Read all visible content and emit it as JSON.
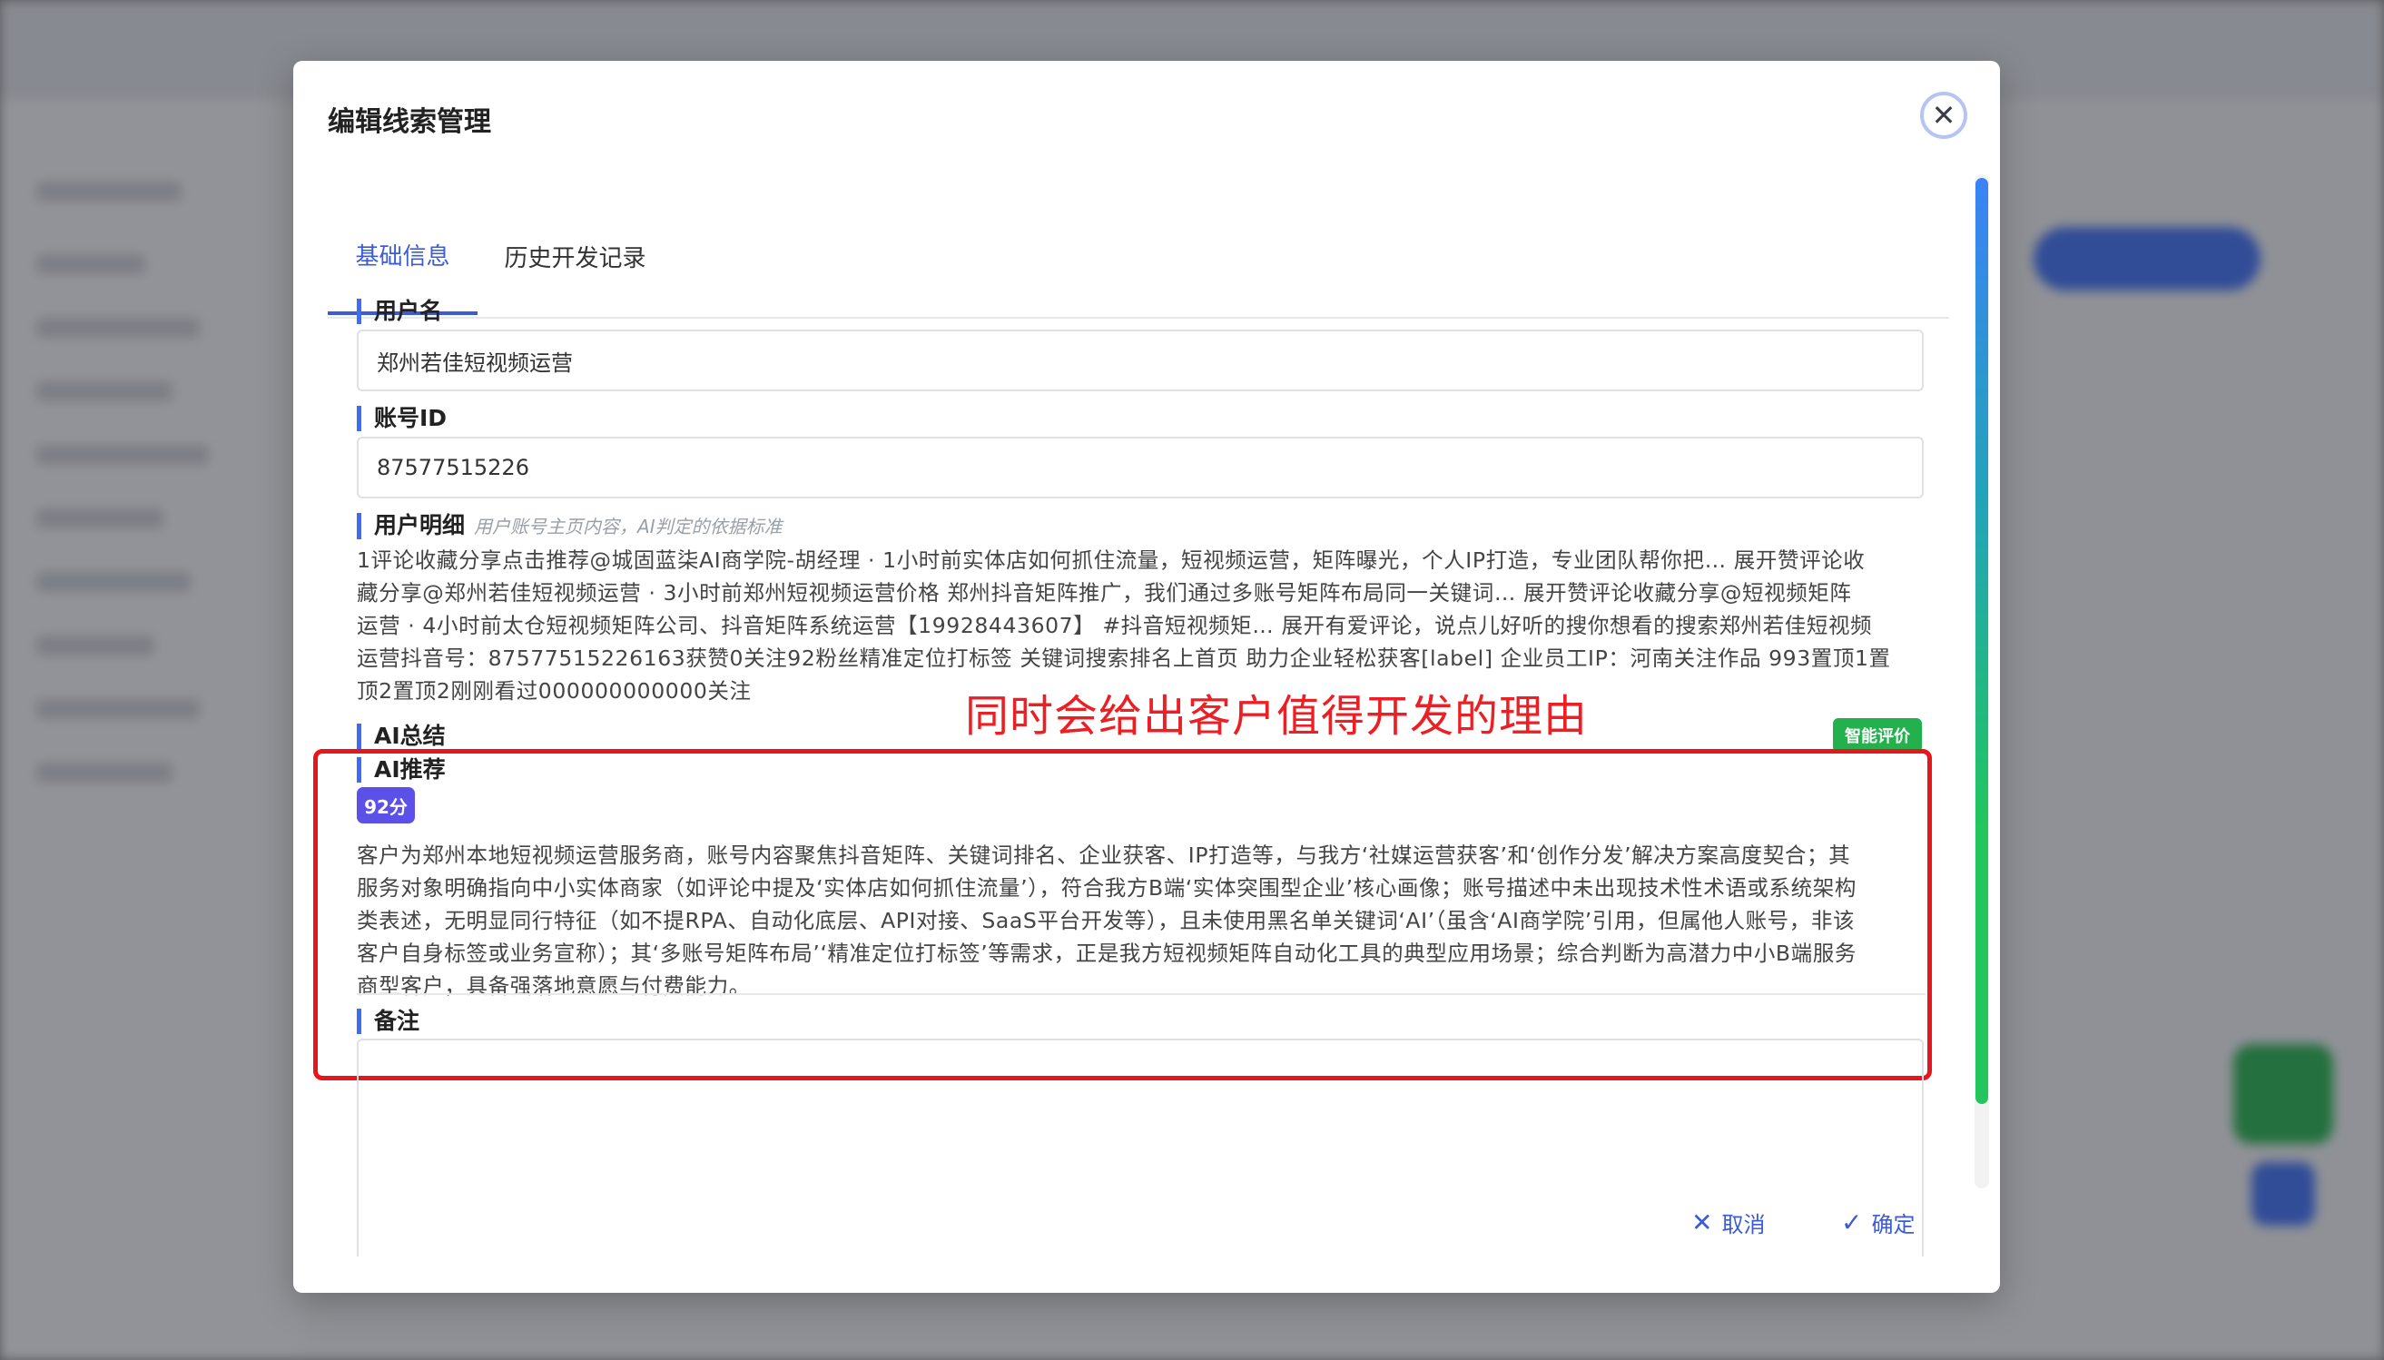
{
  "modal": {
    "title": "编辑线索管理",
    "close_icon": "close-icon"
  },
  "tabs": [
    {
      "label": "基础信息",
      "active": true
    },
    {
      "label": "历史开发记录",
      "active": false
    }
  ],
  "fields": {
    "username": {
      "label": "用户名",
      "value": "郑州若佳短视频运营"
    },
    "account_id": {
      "label": "账号ID",
      "value": "87577515226"
    },
    "user_detail": {
      "label": "用户明细",
      "hint": "用户账号主页内容，AI判定的依据标准",
      "lines": [
        "1评论收藏分享点击推荐@城固蓝柒AI商学院-胡经理 · 1小时前实体店如何抓住流量，短视频运营，矩阵曝光，个人IP打造，专业团队帮你把… 展开赞评论收",
        "藏分享@郑州若佳短视频运营 · 3小时前郑州短视频运营价格 郑州抖音矩阵推广，我们通过多账号矩阵布局同一关键词… 展开赞评论收藏分享@短视频矩阵",
        "运营 · 4小时前太仓短视频矩阵公司、抖音矩阵系统运营【19928443607】 #抖音短视频矩… 展开有爱评论，说点儿好听的搜你想看的搜索郑州若佳短视频",
        "运营抖音号：87577515226163获赞0关注92粉丝精准定位打标签 关键词搜索排名上首页 助力企业轻松获客[label] 企业员工IP：河南关注作品 993置顶1置",
        "顶2置顶2刚刚看过000000000000关注"
      ]
    },
    "ai_summary": {
      "label": "AI总结",
      "badge": "智能评价"
    },
    "ai_recommend": {
      "label": "AI推荐",
      "score": "92分",
      "lines": [
        "客户为郑州本地短视频运营服务商，账号内容聚焦抖音矩阵、关键词排名、企业获客、IP打造等，与我方‘社媒运营获客’和‘创作分发’解决方案高度契合；其",
        "服务对象明确指向中小实体商家（如评论中提及‘实体店如何抓住流量’），符合我方B端‘实体突围型企业’核心画像；账号描述中未出现技术性术语或系统架构",
        "类表述，无明显同行特征（如不提RPA、自动化底层、API对接、SaaS平台开发等），且未使用黑名单关键词‘AI’（虽含‘AI商学院’引用，但属他人账号，非该",
        "客户自身标签或业务宣称）；其‘多账号矩阵布局’‘精准定位打标签’等需求，正是我方短视频矩阵自动化工具的典型应用场景；综合判断为高潜力中小B端服务",
        "商型客户，具备强落地意愿与付费能力。"
      ]
    },
    "remark": {
      "label": "备注",
      "value": ""
    }
  },
  "annotation": {
    "text": "同时会给出客户值得开发的理由",
    "color": "#ec1f24"
  },
  "footer": {
    "cancel_label": "取消",
    "confirm_label": "确定"
  },
  "colors": {
    "accent": "#3b5bdb",
    "score_badge": "#5b50e8",
    "smart_badge": "#22b14c",
    "section_bar": "#3b6ef5"
  }
}
